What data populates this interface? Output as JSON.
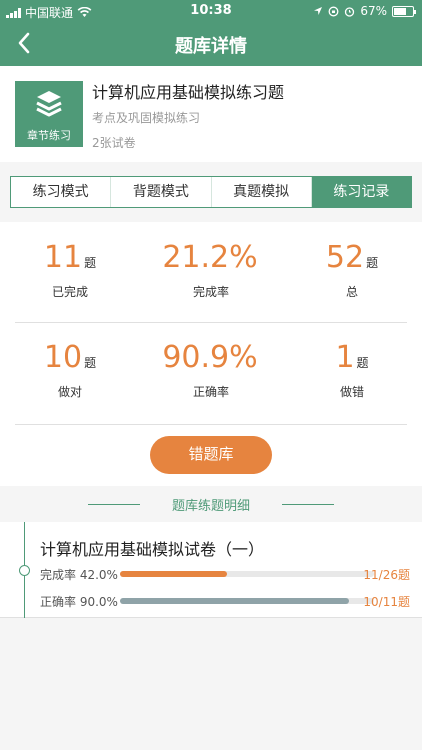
{
  "status_bar": {
    "carrier": "中国联通",
    "time": "10:38",
    "battery": "67%",
    "battery_level": 0.67
  },
  "nav": {
    "title": "题库详情"
  },
  "bank": {
    "thumb_label": "章节练习",
    "title": "计算机应用基础模拟练习题",
    "subtitle": "考点及巩固模拟练习",
    "paper_count": "2张试卷"
  },
  "tabs": [
    {
      "label": "练习模式",
      "active": false
    },
    {
      "label": "背题模式",
      "active": false
    },
    {
      "label": "真题模拟",
      "active": false
    },
    {
      "label": "练习记录",
      "active": true
    }
  ],
  "stats": [
    {
      "value": "11",
      "unit": "题",
      "label": "已完成"
    },
    {
      "value": "21.2%",
      "unit": "",
      "label": "完成率"
    },
    {
      "value": "52",
      "unit": "题",
      "label": "总"
    },
    {
      "value": "10",
      "unit": "题",
      "label": "做对"
    },
    {
      "value": "90.9%",
      "unit": "",
      "label": "正确率"
    },
    {
      "value": "1",
      "unit": "题",
      "label": "做错"
    }
  ],
  "wrong_button": {
    "label": "错题库"
  },
  "section": {
    "title": "题库练题明细"
  },
  "papers": [
    {
      "title": "计算机应用基础模拟试卷（一）",
      "completion": {
        "label": "完成率 42.0%",
        "fraction": 0.42,
        "ratio": "11/26题",
        "color": "#e6843f"
      },
      "accuracy": {
        "label": "正确率 90.0%",
        "fraction": 0.9,
        "ratio": "10/11题",
        "color": "#8fa3a8"
      }
    }
  ],
  "colors": {
    "primary": "#4f9a78",
    "accent": "#e6843f"
  }
}
